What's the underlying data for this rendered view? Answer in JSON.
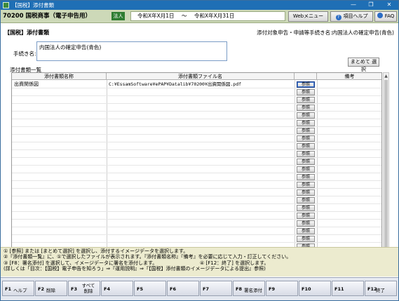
{
  "window": {
    "title": "【国税】添付書類",
    "min": "—",
    "max": "❐",
    "close": "✕"
  },
  "header": {
    "app_name": "70200 国税商事（電子申告用）",
    "kind": "法人",
    "period_from": "令和X年X月1日",
    "period_sep": "〜",
    "period_to": "令和X年X月31日",
    "web_menu": "Webメニュー",
    "help_icon": "?",
    "item_help": "項目ヘルプ",
    "faq": "FAQ"
  },
  "section": {
    "title": "【国税】添付書類",
    "target_label": "添付対象申告・申請等手続き名:内国法人の確定申告(青色)",
    "procedure_label": "手続き名:",
    "procedure_value": "内国法人の確定申告(青色)",
    "bulk_select": "まとめて 選択",
    "list_title": "添付書類一覧"
  },
  "grid": {
    "columns": [
      "添付書類名称",
      "添付書類ファイル名",
      "",
      "備考"
    ],
    "ref_label": "参照",
    "rows": [
      {
        "name": "出資関係図",
        "file": "C:¥EssamSoftware¥ePAP¥Datalib¥70200¥出資関係図.pdf",
        "note": ""
      },
      {
        "name": "",
        "file": "",
        "note": ""
      },
      {
        "name": "",
        "file": "",
        "note": ""
      },
      {
        "name": "",
        "file": "",
        "note": ""
      },
      {
        "name": "",
        "file": "",
        "note": ""
      },
      {
        "name": "",
        "file": "",
        "note": ""
      },
      {
        "name": "",
        "file": "",
        "note": ""
      },
      {
        "name": "",
        "file": "",
        "note": ""
      },
      {
        "name": "",
        "file": "",
        "note": ""
      },
      {
        "name": "",
        "file": "",
        "note": ""
      },
      {
        "name": "",
        "file": "",
        "note": ""
      },
      {
        "name": "",
        "file": "",
        "note": ""
      },
      {
        "name": "",
        "file": "",
        "note": ""
      },
      {
        "name": "",
        "file": "",
        "note": ""
      },
      {
        "name": "",
        "file": "",
        "note": ""
      },
      {
        "name": "",
        "file": "",
        "note": ""
      },
      {
        "name": "",
        "file": "",
        "note": ""
      },
      {
        "name": "",
        "file": "",
        "note": ""
      },
      {
        "name": "",
        "file": "",
        "note": ""
      },
      {
        "name": "",
        "file": "",
        "note": ""
      },
      {
        "name": "",
        "file": "",
        "note": ""
      },
      {
        "name": "",
        "file": "",
        "note": ""
      },
      {
        "name": "",
        "file": "",
        "note": ""
      }
    ]
  },
  "notes": {
    "line1": "① [参照] または [まとめて選択] を選択し、添付するイメージデータを選択します。",
    "line2": "②『添付書類一覧』に、①で選択したファイルが表示されます。『添付書類名称』『備考』を必要に応じて入力・訂正してください。",
    "line3": "③ [F8：署名添付] を選択して、イメージデータに署名を添付します。",
    "line4": "④ [F12：終了] を選択します。",
    "line5": "(詳しくは「目次：【国税】電子申告を知ろう」⇒『運用説明』⇒『【国税】添付書類のイメージデータによる提出』参照)"
  },
  "fkeys": [
    {
      "key": "F1",
      "label": "ヘルプ"
    },
    {
      "key": "F2",
      "label": "削除"
    },
    {
      "key": "F3",
      "label": "すべて\n削除"
    },
    {
      "key": "F4",
      "label": ""
    },
    {
      "key": "F5",
      "label": ""
    },
    {
      "key": "F6",
      "label": ""
    },
    {
      "key": "F7",
      "label": ""
    },
    {
      "key": "F8",
      "label": "署名添付"
    },
    {
      "key": "F9",
      "label": ""
    },
    {
      "key": "F10",
      "label": ""
    },
    {
      "key": "F11",
      "label": ""
    },
    {
      "key": "F12",
      "label": "終了"
    }
  ]
}
